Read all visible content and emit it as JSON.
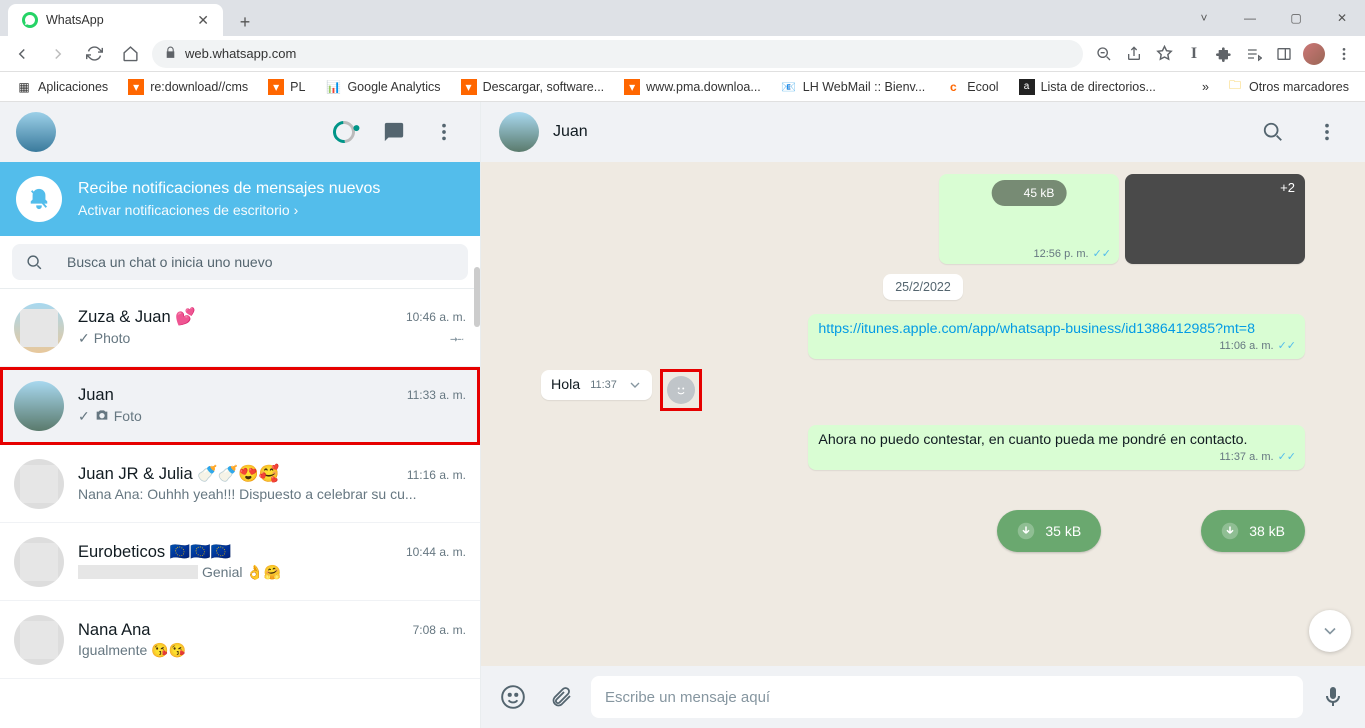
{
  "browser": {
    "tab_title": "WhatsApp",
    "url": "web.whatsapp.com",
    "bookmarks_label": "Aplicaciones",
    "bookmarks": [
      {
        "label": "re:download//cms"
      },
      {
        "label": "PL"
      },
      {
        "label": "Google Analytics"
      },
      {
        "label": "Descargar, software..."
      },
      {
        "label": "www.pma.downloa..."
      },
      {
        "label": "LH WebMail :: Bienv..."
      },
      {
        "label": "Ecool"
      },
      {
        "label": "Lista de directorios..."
      }
    ],
    "other_bookmarks": "Otros marcadores"
  },
  "sidebar": {
    "notice_title": "Recibe notificaciones de mensajes nuevos",
    "notice_sub": "Activar notificaciones de escritorio",
    "search_placeholder": "Busca un chat o inicia uno nuevo"
  },
  "chats": [
    {
      "name": "Zuza & Juan 💕",
      "time": "10:46 a. m.",
      "preview": "Photo",
      "pinned": true,
      "check": true,
      "camera": false
    },
    {
      "name": "Juan",
      "time": "11:33 a. m.",
      "preview": "Foto",
      "pinned": false,
      "check": true,
      "camera": true,
      "selected": true,
      "highlight": true
    },
    {
      "name": "Juan JR & Julia 🍼🍼😍🥰",
      "time": "11:16 a. m.",
      "preview": "Nana Ana: Ouhhh yeah!!! Dispuesto a celebrar su cu...",
      "pinned": false
    },
    {
      "name": "Eurobeticos 🇪🇺🇪🇺🇪🇺",
      "time": "10:44 a. m.",
      "preview_suffix": " Genial 👌🤗",
      "pinned": false,
      "blurpart": true
    },
    {
      "name": "Nana Ana",
      "time": "7:08 a. m.",
      "preview": "Igualmente 😘😘",
      "pinned": false
    }
  ],
  "conversation": {
    "contact": "Juan",
    "top_attach": {
      "size": "45 kB",
      "count": "+2",
      "time": "12:56 p. m."
    },
    "date_sep": "25/2/2022",
    "link_msg": {
      "text": "https://itunes.apple.com/app/whatsapp-business/id1386412985?mt=8",
      "time": "11:06 a. m."
    },
    "in_msg": {
      "text": "Hola",
      "time": "11:37"
    },
    "reply_msg": {
      "text": "Ahora no puedo contestar, en cuanto pueda me pondré en contacto.",
      "time": "11:37 a. m."
    },
    "dl1": "35 kB",
    "dl2": "38 kB",
    "composer_placeholder": "Escribe un mensaje aquí"
  }
}
